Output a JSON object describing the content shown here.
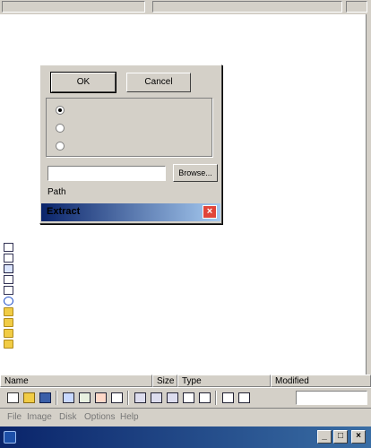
{
  "status": {
    "left": "",
    "right": ""
  },
  "dialog": {
    "title": "Extract",
    "ok_label": "OK",
    "cancel_label": "Cancel",
    "options": [
      {
        "label": "",
        "selected": true
      },
      {
        "label": "",
        "selected": false
      },
      {
        "label": "",
        "selected": false
      }
    ],
    "group_caption": "",
    "directory_value": "",
    "browse_label": "Browse...",
    "path_label": "Path"
  },
  "files": [
    {
      "name": "",
      "size": "",
      "type": "",
      "modified": "",
      "icon": "document"
    },
    {
      "name": "",
      "size": "",
      "type": "",
      "modified": "",
      "icon": "document"
    },
    {
      "name": "",
      "size": "",
      "type": "",
      "modified": "",
      "icon": "application"
    },
    {
      "name": "",
      "size": "",
      "type": "",
      "modified": "",
      "icon": "document"
    },
    {
      "name": "",
      "size": "",
      "type": "",
      "modified": "",
      "icon": "document"
    },
    {
      "name": "",
      "size": "",
      "type": "",
      "modified": "",
      "icon": "setup-info"
    },
    {
      "name": "",
      "size": "",
      "type": "",
      "modified": "",
      "icon": "folder"
    },
    {
      "name": "",
      "size": "",
      "type": "",
      "modified": "",
      "icon": "folder"
    },
    {
      "name": "",
      "size": "",
      "type": "",
      "modified": "",
      "icon": "folder"
    },
    {
      "name": "",
      "size": "",
      "type": "",
      "modified": "",
      "icon": "folder"
    }
  ],
  "columns": {
    "name": "Name",
    "size": "Size",
    "type": "Type",
    "modified": "Modified"
  },
  "toolbar": {
    "label": "",
    "combo_value": ""
  },
  "menu": [
    "File",
    "Image",
    "Disk",
    "Options",
    "Help"
  ],
  "window": {
    "title": ""
  },
  "colors": {
    "title_gradient_start": "#0a246a",
    "title_gradient_end": "#3a6ea5",
    "face": "#d4d0c8",
    "close_red": "#e0453a",
    "folder_yellow": "#f1cc45"
  }
}
